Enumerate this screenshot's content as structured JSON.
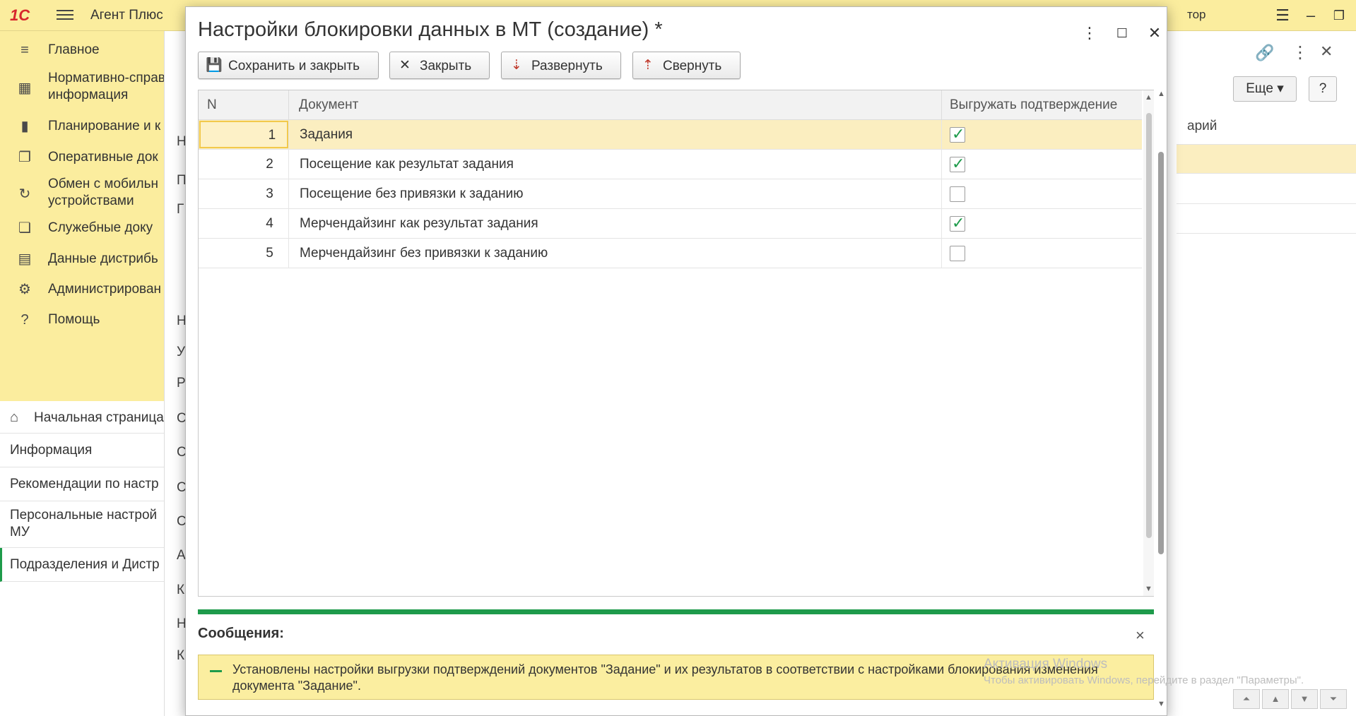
{
  "app": {
    "title": "Агент Плюс",
    "user": "тор"
  },
  "sidebar": {
    "items": [
      {
        "label": "Главное"
      },
      {
        "label": "Нормативно-справ\nинформация"
      },
      {
        "label": "Планирование и к"
      },
      {
        "label": "Оперативные док"
      },
      {
        "label": "Обмен с мобильн\nустройствами"
      },
      {
        "label": "Служебные доку"
      },
      {
        "label": "Данные дистрибь"
      },
      {
        "label": "Администрирован"
      },
      {
        "label": "Помощь"
      }
    ]
  },
  "open_windows": [
    {
      "label": "Начальная страница"
    },
    {
      "label": "Информация"
    },
    {
      "label": "Рекомендации по настр"
    },
    {
      "label": "Персональные настрой\nМУ"
    },
    {
      "label": "Подразделения и Дистр"
    }
  ],
  "background_form": {
    "letters": [
      "Н",
      "П",
      "Г",
      "Н",
      "У",
      "Р",
      "С",
      "С",
      "С",
      "С",
      "А",
      "К",
      "Н",
      "К"
    ],
    "more_label": "Еще",
    "help_label": "?",
    "col_header": "арий"
  },
  "modal": {
    "title": "Настройки блокировки данных в МТ (создание) *",
    "toolbar": {
      "save_close": "Сохранить и закрыть",
      "close": "Закрыть",
      "expand": "Развернуть",
      "collapse": "Свернуть"
    },
    "grid": {
      "headers": {
        "n": "N",
        "document": "Документ",
        "upload_confirm": "Выгружать подтверждение"
      },
      "rows": [
        {
          "n": "1",
          "document": "Задания",
          "checked": true
        },
        {
          "n": "2",
          "document": "Посещение как результат задания",
          "checked": true
        },
        {
          "n": "3",
          "document": "Посещение без привязки к заданию",
          "checked": false
        },
        {
          "n": "4",
          "document": "Мерчендайзинг как результат задания",
          "checked": true
        },
        {
          "n": "5",
          "document": "Мерчендайзинг без привязки к заданию",
          "checked": false
        }
      ]
    },
    "messages": {
      "title": "Сообщения:",
      "text": "Установлены настройки выгрузки подтверждений документов \"Задание\" и их результатов в соответствии с настройками блокирования изменения документа \"Задание\"."
    }
  },
  "watermark": {
    "line1": "Активация Windows",
    "line2": "Чтобы активировать Windows, перейдите в раздел \"Параметры\"."
  },
  "colors": {
    "accent_green": "#1e9b4b",
    "sidebar_yellow": "#fbed9e",
    "selected_row": "#fbeec0"
  }
}
